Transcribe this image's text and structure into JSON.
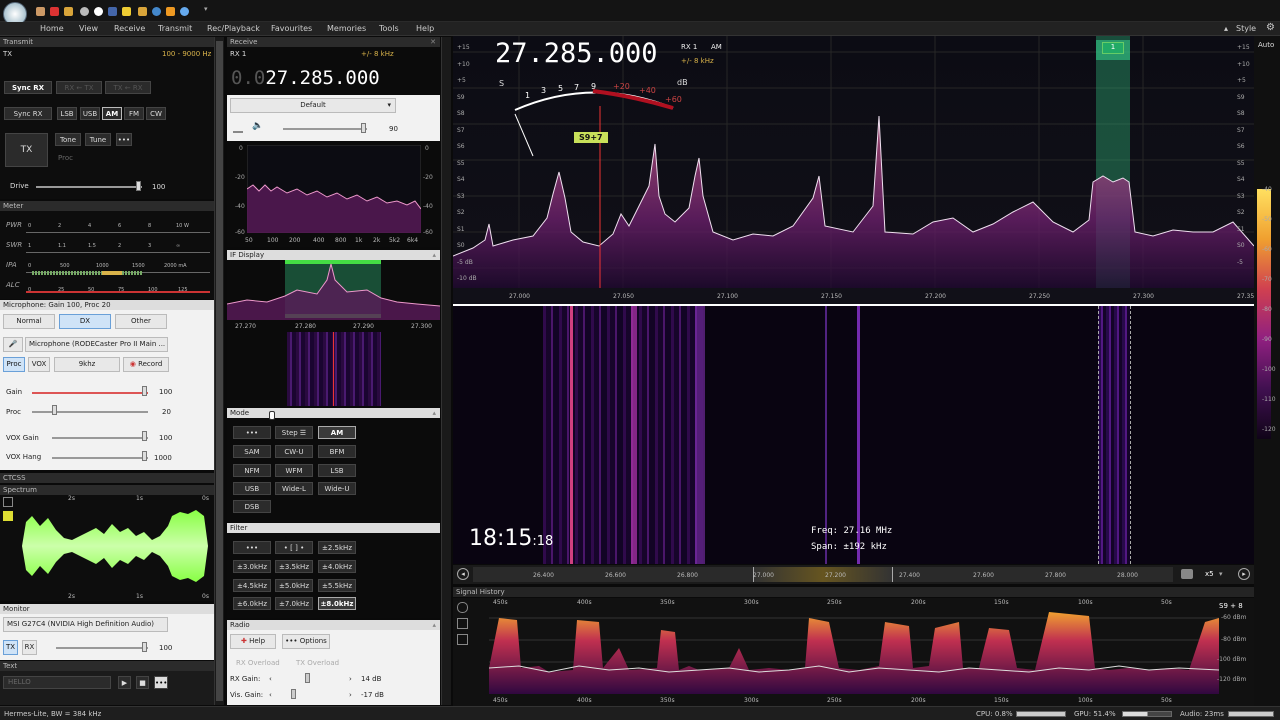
{
  "menu": [
    "Home",
    "View",
    "Receive",
    "Transmit",
    "Rec/Playback",
    "Favourites",
    "Memories",
    "Tools",
    "Help"
  ],
  "style_label": "Style",
  "tx_panel": {
    "title": "Transmit",
    "tx_label": "TX",
    "range": "100 - 9000 Hz",
    "sync_rx": "Sync RX",
    "rx_to_tx": "RX ← TX",
    "tx_to_rx": "TX ← RX",
    "sync_rx2": "Sync RX",
    "modes": [
      "LSB",
      "USB",
      "AM",
      "FM",
      "CW"
    ],
    "tx_button": "TX",
    "tone": "Tone",
    "tune": "Tune",
    "more": "•••",
    "proc": "Proc",
    "drive_label": "Drive",
    "drive_value": "100"
  },
  "meter": {
    "title": "Meter",
    "rows": [
      {
        "label": "PWR",
        "ticks": [
          "0",
          "2",
          "4",
          "6",
          "8",
          "10 W"
        ]
      },
      {
        "label": "SWR",
        "ticks": [
          "1",
          "1.1",
          "1.5",
          "2",
          "3",
          "∞"
        ]
      },
      {
        "label": "IPA",
        "ticks": [
          "0",
          "500",
          "1000",
          "1500",
          "2000 mA"
        ]
      },
      {
        "label": "ALC",
        "ticks": [
          "0",
          "25",
          "50",
          "75",
          "100",
          "125"
        ]
      }
    ]
  },
  "mic": {
    "title": "Microphone: Gain 100, Proc 20",
    "presets": [
      "Normal",
      "DX",
      "Other"
    ],
    "device": "Microphone (RODECaster Pro II Main ...",
    "proc": "Proc",
    "vox": "VOX",
    "bw": "9khz",
    "record": "Record",
    "gain_label": "Gain",
    "gain_value": "100",
    "proc_label": "Proc",
    "proc_value": "20",
    "vox_gain_label": "VOX Gain",
    "vox_gain_value": "100",
    "vox_hang_label": "VOX Hang",
    "vox_hang_value": "1000"
  },
  "ctcss_title": "CTCSS",
  "spectrum_small": {
    "title": "Spectrum",
    "top_ticks": [
      "2s",
      "1s",
      "0s"
    ],
    "bottom_ticks": [
      "2s",
      "1s",
      "0s"
    ]
  },
  "monitor": {
    "title": "Monitor",
    "device": "MSI G27C4 (NVIDIA High Definition Audio)",
    "tx": "TX",
    "rx": "RX",
    "value": "100"
  },
  "text_panel": {
    "title": "Text",
    "value": "HELLO"
  },
  "receive": {
    "title": "Receive",
    "rx": "RX 1",
    "bw": "+/- 8 kHz",
    "freq_dim": "0.0",
    "freq": "27.285.000",
    "profile": "Default",
    "volume": "90",
    "audio_y": [
      "0",
      "-20",
      "-40",
      "-60"
    ],
    "audio_y_right": [
      "0",
      "-20",
      "-40",
      "-60"
    ],
    "audio_x": [
      "50",
      "100",
      "200",
      "400",
      "800",
      "1k",
      "2k",
      "5k2",
      "6k4"
    ]
  },
  "if_display": {
    "title": "IF Display",
    "x": [
      "27.270",
      "27.280",
      "27.290",
      "27.300"
    ]
  },
  "mode": {
    "title": "Mode",
    "buttons": [
      "•••",
      "Step ☰",
      "AM",
      "SAM",
      "CW-U",
      "BFM",
      "NFM",
      "WFM",
      "LSB",
      "USB",
      "Wide-L",
      "Wide-U",
      "DSB"
    ]
  },
  "filter": {
    "title": "Filter",
    "buttons": [
      "•••",
      "• [ ] •",
      "±2.5kHz",
      "±3.0kHz",
      "±3.5kHz",
      "±4.0kHz",
      "±4.5kHz",
      "±5.0kHz",
      "±5.5kHz",
      "±6.0kHz",
      "±7.0kHz",
      "±8.0kHz"
    ]
  },
  "radio": {
    "title": "Radio",
    "help": "Help",
    "options": "Options",
    "rx_overload": "RX Overload",
    "tx_overload": "TX Overload",
    "rx_gain_label": "RX Gain:",
    "rx_gain_value": "14 dB",
    "vis_gain_label": "Vis. Gain:",
    "vis_gain_value": "-17 dB"
  },
  "main": {
    "freq": "27.285.000",
    "rx": "RX 1",
    "mode": "AM",
    "bw": "+/- 8 kHz",
    "smeter_label": "S",
    "smeter_ticks": [
      "1",
      "3",
      "5",
      "7",
      "9",
      "+20",
      "+40",
      "+60"
    ],
    "smeter_db": "dB",
    "smeter_reading": "S9+7",
    "y_left": [
      "+15",
      "+10",
      "+5",
      "S9",
      "S8",
      "S7",
      "S6",
      "S5",
      "S4",
      "S3",
      "S2",
      "S1",
      "S0",
      "-5 dB",
      "-10 dB"
    ],
    "y_right": [
      "+15",
      "+10",
      "+5",
      "S9",
      "S8",
      "S7",
      "S6",
      "S5",
      "S4",
      "S3",
      "S2",
      "S1",
      "S0",
      "-5"
    ],
    "x": [
      "27.000",
      "27.050",
      "27.100",
      "27.150",
      "27.200",
      "27.250",
      "27.300",
      "27.35"
    ],
    "marker": "1",
    "auto": "Auto"
  },
  "waterfall": {
    "time": "18:15",
    "seconds": ":18",
    "freq_label": "Freq:",
    "freq": "27.16 MHz",
    "span_label": "Span:",
    "span": "±192 kHz"
  },
  "overview": {
    "x": [
      "26.400",
      "26.600",
      "26.800",
      "27.000",
      "27.200",
      "27.400",
      "27.600",
      "27.800",
      "28.000"
    ],
    "zoom": "x5"
  },
  "history": {
    "title": "Signal History",
    "top_ticks": [
      "450s",
      "400s",
      "350s",
      "300s",
      "250s",
      "200s",
      "150s",
      "100s",
      "50s"
    ],
    "bottom_ticks": [
      "450s",
      "400s",
      "350s",
      "300s",
      "250s",
      "200s",
      "150s",
      "100s",
      "50s"
    ],
    "y": [
      "-60 dBm",
      "-80 dBm",
      "-100 dBm",
      "-120 dBm"
    ],
    "reading": "S9 + 8"
  },
  "right_scale": [
    "-40",
    "-50",
    "-60",
    "-70",
    "-80",
    "-90",
    "-100",
    "-110",
    "-120"
  ],
  "status": {
    "left": "Hermes-Lite, BW = 384 kHz",
    "cpu": "CPU: 0.8%",
    "gpu": "GPU: 51.4%",
    "audio": "Audio: 23ms"
  }
}
